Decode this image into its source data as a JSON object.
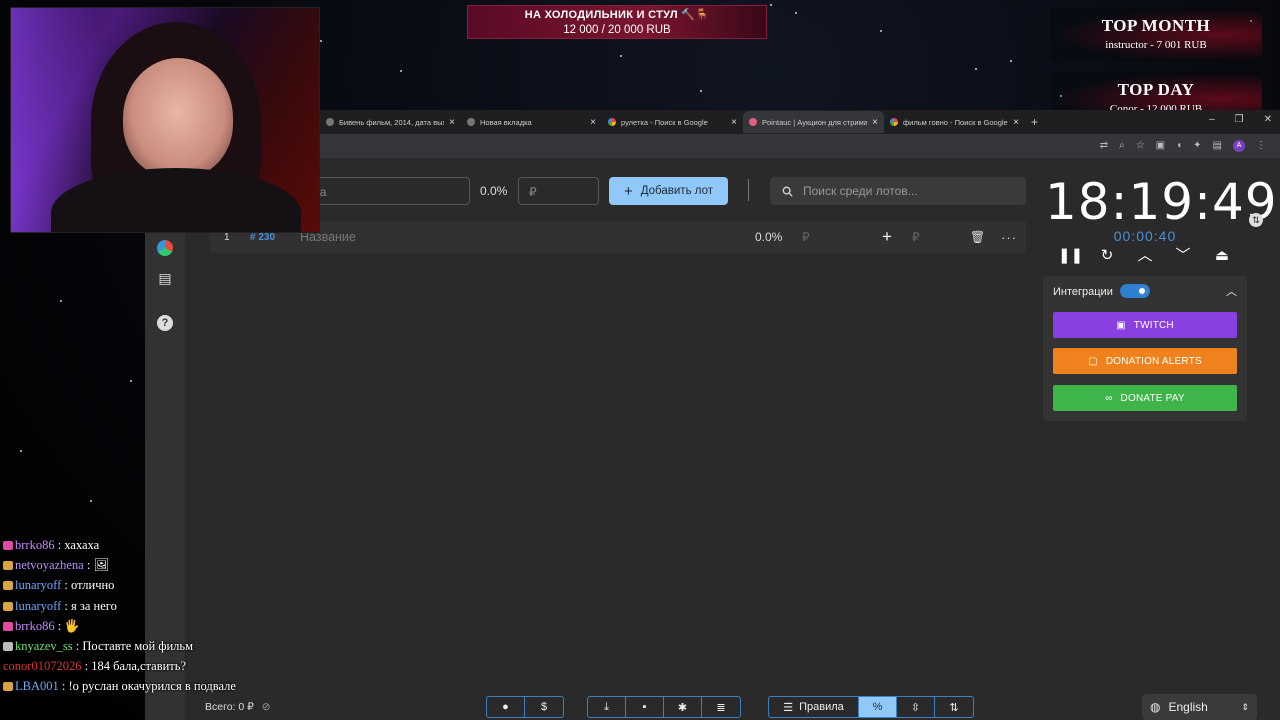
{
  "overlay": {
    "goal": {
      "title": "НА ХОЛОДИЛЬНИК И СТУЛ 🔨🪑",
      "amount": "12 000 / 20 000 RUB"
    },
    "top_month": {
      "title": "TOP MONTH",
      "line": "instructor - 7 001 RUB"
    },
    "top_day": {
      "title": "TOP DAY",
      "line": "Conor - 12 000 RUB"
    }
  },
  "browser": {
    "tabs": [
      {
        "title": "Бивень фильм, 2014, дата вых",
        "icon": "page-icon",
        "active": false
      },
      {
        "title": "Новая вкладка",
        "icon": "page-icon",
        "active": false
      },
      {
        "title": "рулетка - Поиск в Google",
        "icon": "google-icon",
        "active": false
      },
      {
        "title": "Pointauc | Аукцион для стрима",
        "icon": "pointauc-icon",
        "active": true
      },
      {
        "title": "фильм говно - Поиск в Google",
        "icon": "google-icon",
        "active": false
      }
    ],
    "close_glyph": "×",
    "new_tab_glyph": "+",
    "window_controls": [
      "–",
      "❐",
      "✕"
    ],
    "profile_initial": "A"
  },
  "auction": {
    "lot_name_placeholder": "ота",
    "percent": "0.0%",
    "amount_placeholder": "₽",
    "add_label": "Добавить лот",
    "search_placeholder": "Поиск среди лотов...",
    "lot": {
      "num": "1",
      "id": "# 230",
      "name": "Название",
      "percent": "0.0%",
      "currency": "₽"
    },
    "total": "Всего: 0 ₽"
  },
  "timer": {
    "main": "18:19:49",
    "sub": "00:00:40"
  },
  "integrations": {
    "title": "Интеграции",
    "enabled": true,
    "buttons": [
      {
        "label": "TWITCH",
        "color": "#8a3fe0",
        "icon": "twitch-icon"
      },
      {
        "label": "DONATION ALERTS",
        "color": "#f0821e",
        "icon": "donationalerts-icon"
      },
      {
        "label": "DONATE PAY",
        "color": "#3fb44a",
        "icon": "donatepay-icon"
      }
    ]
  },
  "bottom": {
    "rules_label": "Правила",
    "percent_glyph": "%",
    "language": "English"
  },
  "chat": [
    {
      "user": "brrko86",
      "color": "#c58bff",
      "badge": "#e04aa0",
      "text": "хахаха"
    },
    {
      "user": "netvoyazhena",
      "color": "#b98cff",
      "badge": "#d9a441",
      "text": "🖼"
    },
    {
      "user": "lunaryoff",
      "color": "#6fa8ff",
      "badge": "#d9a441",
      "text": "отлично"
    },
    {
      "user": "lunaryoff",
      "color": "#6fa8ff",
      "badge": "#d9a441",
      "text": "я за него"
    },
    {
      "user": "brrko86",
      "color": "#c58bff",
      "badge": "#e04aa0",
      "text": "🖐"
    },
    {
      "user": "knyazev_ss",
      "color": "#6fe06f",
      "badge": "#bbbbbb",
      "text": "Поставте мой фильм"
    },
    {
      "user": "conor01072026",
      "color": "#e03030",
      "badge": "",
      "text": "184 бала,ставить?"
    },
    {
      "user": "LBA001",
      "color": "#6fa8ff",
      "badge": "#d9a441",
      "text": "!о руслан окачурился в подвале"
    }
  ]
}
